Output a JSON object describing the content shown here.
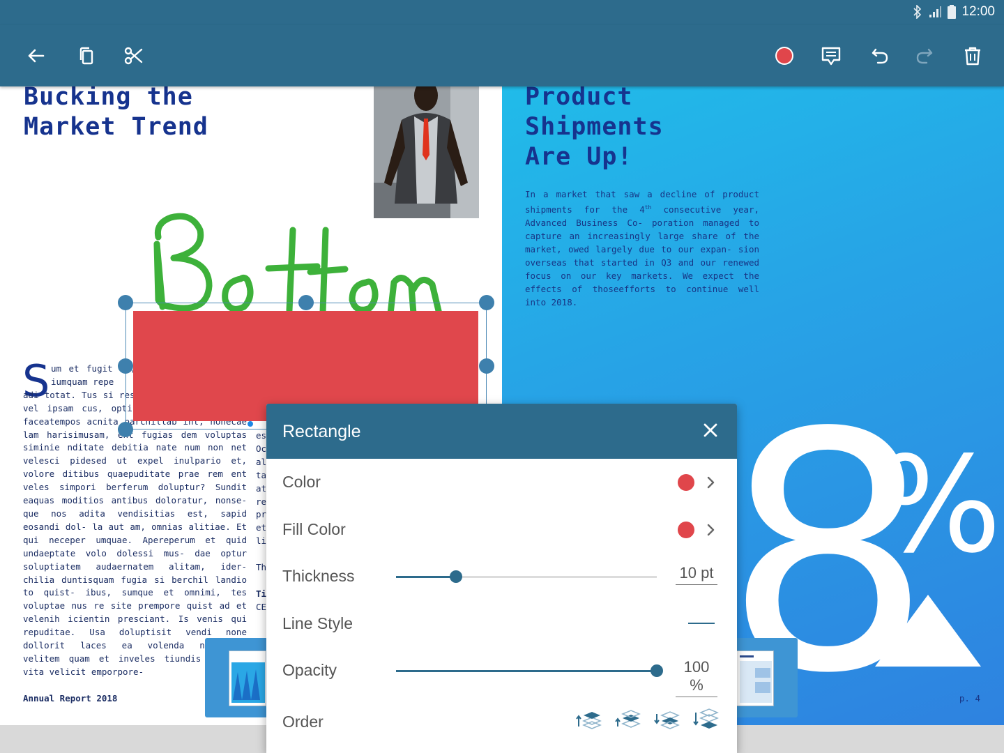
{
  "status": {
    "time": "12:00"
  },
  "document": {
    "left_heading": [
      "Bucking the",
      "Market Trend"
    ],
    "right_heading": [
      "Product",
      "Shipments",
      "Are Up!"
    ],
    "right_paragraph_pre": "In a market that saw a decline of product shipments for the 4",
    "right_paragraph_sup": "th",
    "right_paragraph_post": " consecutive year, Advanced Business Co- poration managed to capture an increasingly large share of the market, owed largely due to our expan- sion overseas that started in Q3 and our renewed focus on our key markets. We expect the effects of thoseefforts to continue well into 2018.",
    "dropcap": "S",
    "body_first": "um et fugit mi, molumquiae dolo rio iumquam repe",
    "body_rest": "adi totat. Tus si res aut niatem voles unt vel ipsam cus, opti abore oulti- issint faceatempos acnita parchillab int, nonecae lam harisimusam, ent fugias dem voluptas siminie nditate debitia nate num non net velesci pidesed ut expel inulpario et, volore ditibus quaepuditate prae rem ent veles simpori berferum doluptur? Sundit eaquas moditios antibus doloratur, nonse- que nos adita vendisitias est, sapid eosandi dol- la aut am, omnias alitiae. Et qui neceper umquae. Apereperum et quid undaeptate volo dolessi mus- dae optur soluptiatem audaernatem alitam, ider- chilia duntisquam fugia si berchil landio to quist- ibus, sumque et omnimi, tes voluptae nus re site prempore quist ad et velenih icientin presciant. Is venis qui repuditae. Usa doluptisit vendi none dollorit laces ea volenda ndicatiam velitem quam et inveles tiundis sequate vita velicit emporpore-",
    "mid_column": [
      "es",
      "Oc",
      "ali",
      "tas",
      "ate",
      "re",
      "pro",
      "etu",
      "liq",
      "",
      "Th",
      "",
      "Tir",
      "CE"
    ],
    "footer_left": "Annual Report 2018",
    "footer_right": "p. 4",
    "big_digit": "8",
    "big_percent": "%"
  },
  "annotation": {
    "ink_text": "Bottom",
    "ink_color": "#3db13a",
    "rect_color": "#e0474c"
  },
  "dialog": {
    "title": "Rectangle",
    "color_label": "Color",
    "color_value": "#e0464b",
    "fill_color_label": "Fill Color",
    "fill_color_value": "#e0464b",
    "thickness_label": "Thickness",
    "thickness_value": "10 pt",
    "thickness_fraction": 0.23,
    "line_style_label": "Line Style",
    "opacity_label": "Opacity",
    "opacity_value": "100 %",
    "opacity_fraction": 1.0,
    "order_label": "Order"
  },
  "icons": {
    "toolbar": [
      "back-arrow-icon",
      "copy-icon",
      "cut-icon",
      "color-record-icon",
      "comment-icon",
      "undo-icon",
      "redo-icon",
      "delete-icon"
    ],
    "status": [
      "bluetooth-icon",
      "signal-icon",
      "battery-icon"
    ],
    "order": [
      "bring-to-front-icon",
      "bring-forward-icon",
      "send-backward-icon",
      "send-to-back-icon"
    ]
  }
}
